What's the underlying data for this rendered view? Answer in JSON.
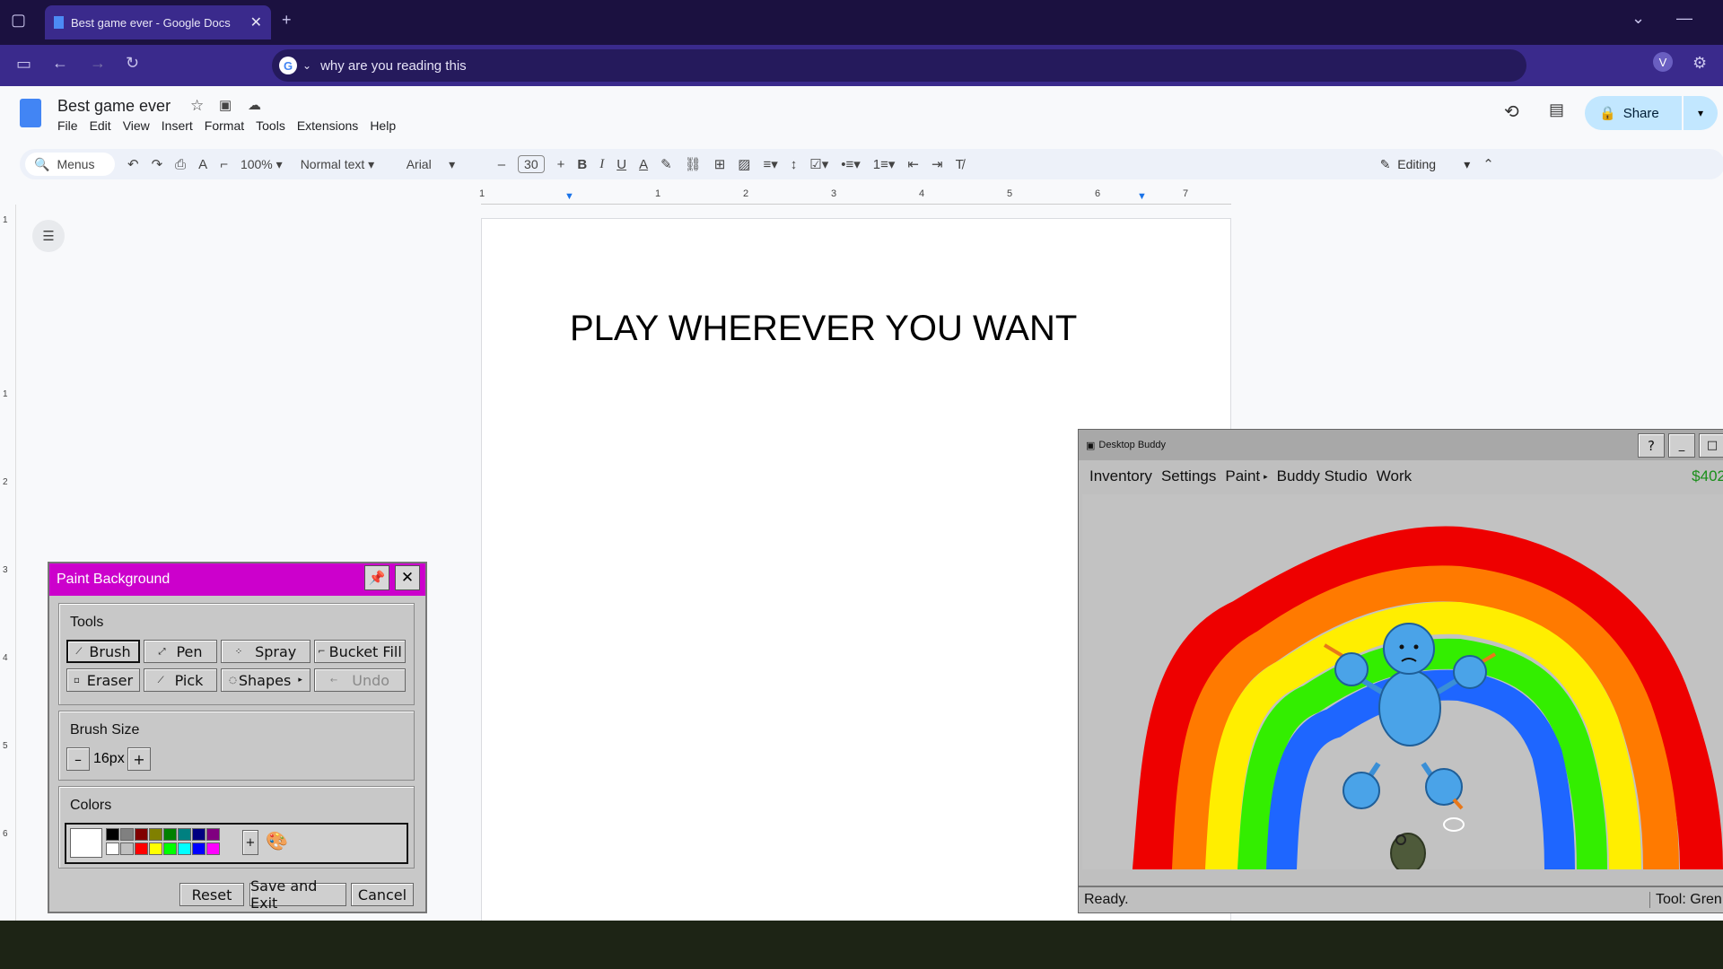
{
  "browser": {
    "tab_title": "Best game ever - Google Docs",
    "address": "why are you reading this",
    "profile_initial": "V"
  },
  "docs": {
    "title": "Best game ever",
    "menus": [
      "File",
      "Edit",
      "View",
      "Insert",
      "Format",
      "Tools",
      "Extensions",
      "Help"
    ],
    "toolbar": {
      "search_label": "Menus",
      "zoom": "100%",
      "style": "Normal text",
      "font": "Arial",
      "font_size": "30",
      "mode": "Editing"
    },
    "share_label": "Share",
    "ruler_numbers": [
      "1",
      "1",
      "2",
      "3",
      "4",
      "5",
      "6",
      "7"
    ],
    "left_ruler_numbers": [
      "1",
      "1",
      "2",
      "3",
      "4",
      "5",
      "6"
    ],
    "body_text": "PLAY WHEREVER YOU WANT"
  },
  "paint": {
    "title": "Paint Background",
    "tools_label": "Tools",
    "tools": [
      "Brush",
      "Pen",
      "Spray",
      "Bucket Fill",
      "Eraser",
      "Pick",
      "Shapes",
      "Undo"
    ],
    "brush_size_label": "Brush Size",
    "brush_size": "16px",
    "minus": "–",
    "plus": "+",
    "colors_label": "Colors",
    "colors_plus": "+",
    "palette_top": [
      "#000000",
      "#808080",
      "#800000",
      "#808000",
      "#008000",
      "#008080",
      "#000080",
      "#800080"
    ],
    "palette_bottom": [
      "#ffffff",
      "#c0c0c0",
      "#ff0000",
      "#ffff00",
      "#00ff00",
      "#00ffff",
      "#0000ff",
      "#ff00ff"
    ],
    "selected_color": "#ffffff",
    "accent_color": "#cc00cc",
    "buttons": [
      "Reset",
      "Save and Exit",
      "Cancel"
    ]
  },
  "buddy": {
    "title": "Desktop Buddy",
    "menu": [
      "Inventory",
      "Settings",
      "Paint",
      "Buddy Studio",
      "Work"
    ],
    "money": "$402",
    "status_left": "Ready.",
    "status_right": "Tool: Gren",
    "help": "?"
  }
}
